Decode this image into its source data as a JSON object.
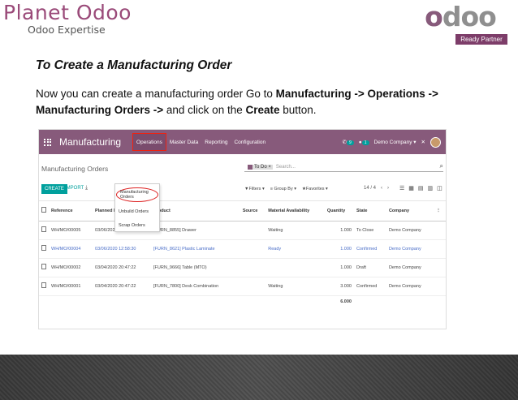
{
  "brand": {
    "left_name": "Planet Odoo",
    "left_sub": "Odoo Expertise",
    "right_logo_o1": "o",
    "right_logo_rest": "doo",
    "right_badge": "Ready Partner"
  },
  "slide": {
    "title": "To Create a Manufacturing Order",
    "text_1": "Now you can create a manufacturing order Go to ",
    "path_bold": "Manufacturing -> Operations -> Manufacturing Orders ->",
    "text_2": " and click on the ",
    "create_bold": "Create",
    "text_3": " button."
  },
  "odoo": {
    "app_name": "Manufacturing",
    "menu": [
      "Operations",
      "Master Data",
      "Reporting",
      "Configuration"
    ],
    "chat_count": "9",
    "activity_count": "1",
    "company_switch": "Demo Company ▾",
    "breadcrumb": "Manufacturing Orders",
    "create_label": "CREATE",
    "import_label": "IMPORT",
    "search_facet": "To Do ×",
    "search_placeholder": "Search...",
    "filters_label": "▼Filters ▾",
    "groupby_label": "≡ Group By ▾",
    "favorites_label": "★Favorites ▾",
    "pager": "14 / 4",
    "dropdown": [
      "Manufacturing Orders",
      "Unbuild Orders",
      "Scrap Orders"
    ],
    "columns": [
      "Reference",
      "Planned Date ▲",
      "Product",
      "Source",
      "Material Availability",
      "Quantity",
      "State",
      "Company"
    ],
    "rows": [
      {
        "ref": "WH/MO/00005",
        "date": "03/06/2020 13:00:47",
        "product": "[FURN_8855] Drawer",
        "source": "",
        "availability": "Waiting",
        "qty": "1.000",
        "state": "To Close",
        "company": "Demo Company",
        "style": ""
      },
      {
        "ref": "WH/MO/00004",
        "date": "03/06/2020 12:58:30",
        "product": "[FURN_8621] Plastic Laminate",
        "source": "",
        "availability": "Ready",
        "qty": "1.000",
        "state": "Confirmed",
        "company": "Demo Company",
        "style": "ready"
      },
      {
        "ref": "WH/MO/00002",
        "date": "03/04/2020 20:47:22",
        "product": "[FURN_9666] Table (MTO)",
        "source": "",
        "availability": "",
        "qty": "1.000",
        "state": "Draft",
        "company": "Demo Company",
        "style": ""
      },
      {
        "ref": "WH/MO/00001",
        "date": "03/04/2020 20:47:22",
        "product": "[FURN_7800] Desk Combination",
        "source": "",
        "availability": "Waiting",
        "qty": "3.000",
        "state": "Confirmed",
        "company": "Demo Company",
        "style": ""
      }
    ],
    "total_qty": "6.000"
  }
}
